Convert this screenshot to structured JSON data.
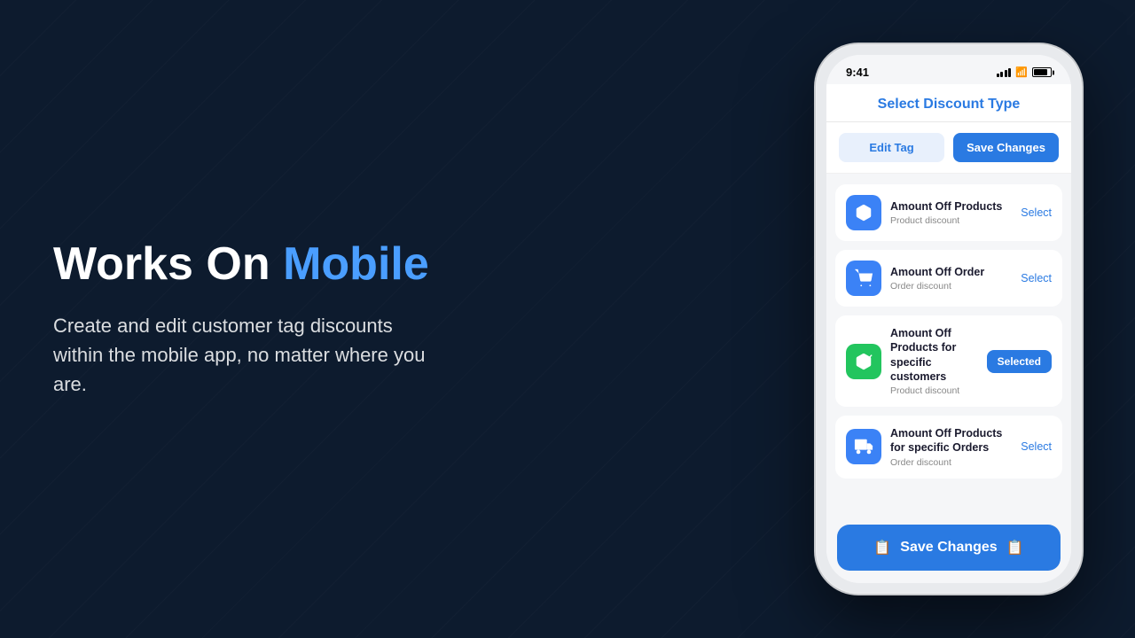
{
  "left": {
    "title_plain": "Works On ",
    "title_highlight": "Mobile",
    "subtitle": "Create and edit customer tag discounts within the mobile app, no matter where you are."
  },
  "phone": {
    "status_time": "9:41",
    "app_title": "Select Discount Type",
    "btn_edit_tag": "Edit Tag",
    "btn_save_top": "Save Changes",
    "btn_save_bottom": "Save Changes",
    "discount_items": [
      {
        "name": "Amount Off Products",
        "sub": "Product discount",
        "icon_type": "blue",
        "icon": "box",
        "action": "Select",
        "selected": false
      },
      {
        "name": "Amount Off Order",
        "sub": "Order discount",
        "icon_type": "blue",
        "icon": "cart",
        "action": "Select",
        "selected": false
      },
      {
        "name": "Amount Off Products for specific customers",
        "sub": "Product discount",
        "icon_type": "green",
        "icon": "box-check",
        "action": "Selected",
        "selected": true
      },
      {
        "name": "Amount Off Products for specific Orders",
        "sub": "Order discount",
        "icon_type": "blue",
        "icon": "truck",
        "action": "Select",
        "selected": false
      }
    ]
  }
}
